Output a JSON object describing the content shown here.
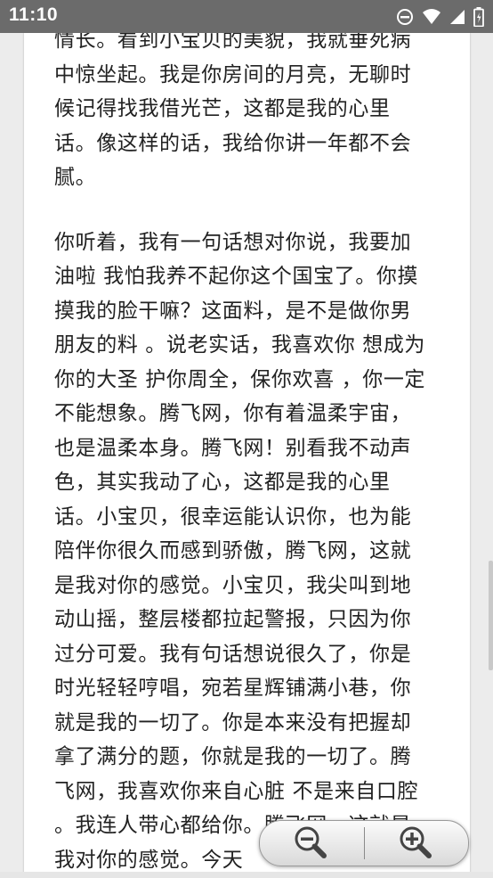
{
  "status_bar": {
    "time": "11:10",
    "icons": [
      "dnd-icon",
      "wifi-icon",
      "signal-icon",
      "battery-icon"
    ]
  },
  "article": {
    "paragraphs": [
      "情长。看到小宝贝的美貌，我就垂死病中惊坐起。我是你房间的月亮，无聊时候记得找我借光芒，这都是我的心里话。像这样的话，我给你讲一年都不会腻。",
      "你听着，我有一句话想对你说，我要加油啦 我怕我养不起你这个国宝了。你摸摸我的脸干嘛？这面料，是不是做你男朋友的料 。说老实话，我喜欢你 想成为你的大圣 护你周全，保你欢喜 ，你一定不能想象。腾飞网，你有着温柔宇宙，也是温柔本身。腾飞网！别看我不动声色，其实我动了心，这都是我的心里话。小宝贝，很幸运能认识你，也为能陪伴你很久而感到骄傲，腾飞网，这就是我对你的感觉。小宝贝，我尖叫到地动山摇，整层楼都拉起警报，只因为你过分可爱。我有句话想说很久了，你是时光轻轻哼唱，宛若星辉铺满小巷，你就是我的一切了。你是本来没有把握却拿了满分的题，你就是我的一切了。腾飞网，我喜欢你来自心脏 不是来自口腔 。我连人带心都给你。腾飞网，这就是我对你的感觉。今天"
    ]
  },
  "zoom": {
    "out_icon": "zoom-out-icon",
    "in_icon": "zoom-in-icon"
  },
  "colors": {
    "status_bar_bg": "#6b6b6b",
    "page_bg": "#ececec",
    "text": "#222222"
  }
}
